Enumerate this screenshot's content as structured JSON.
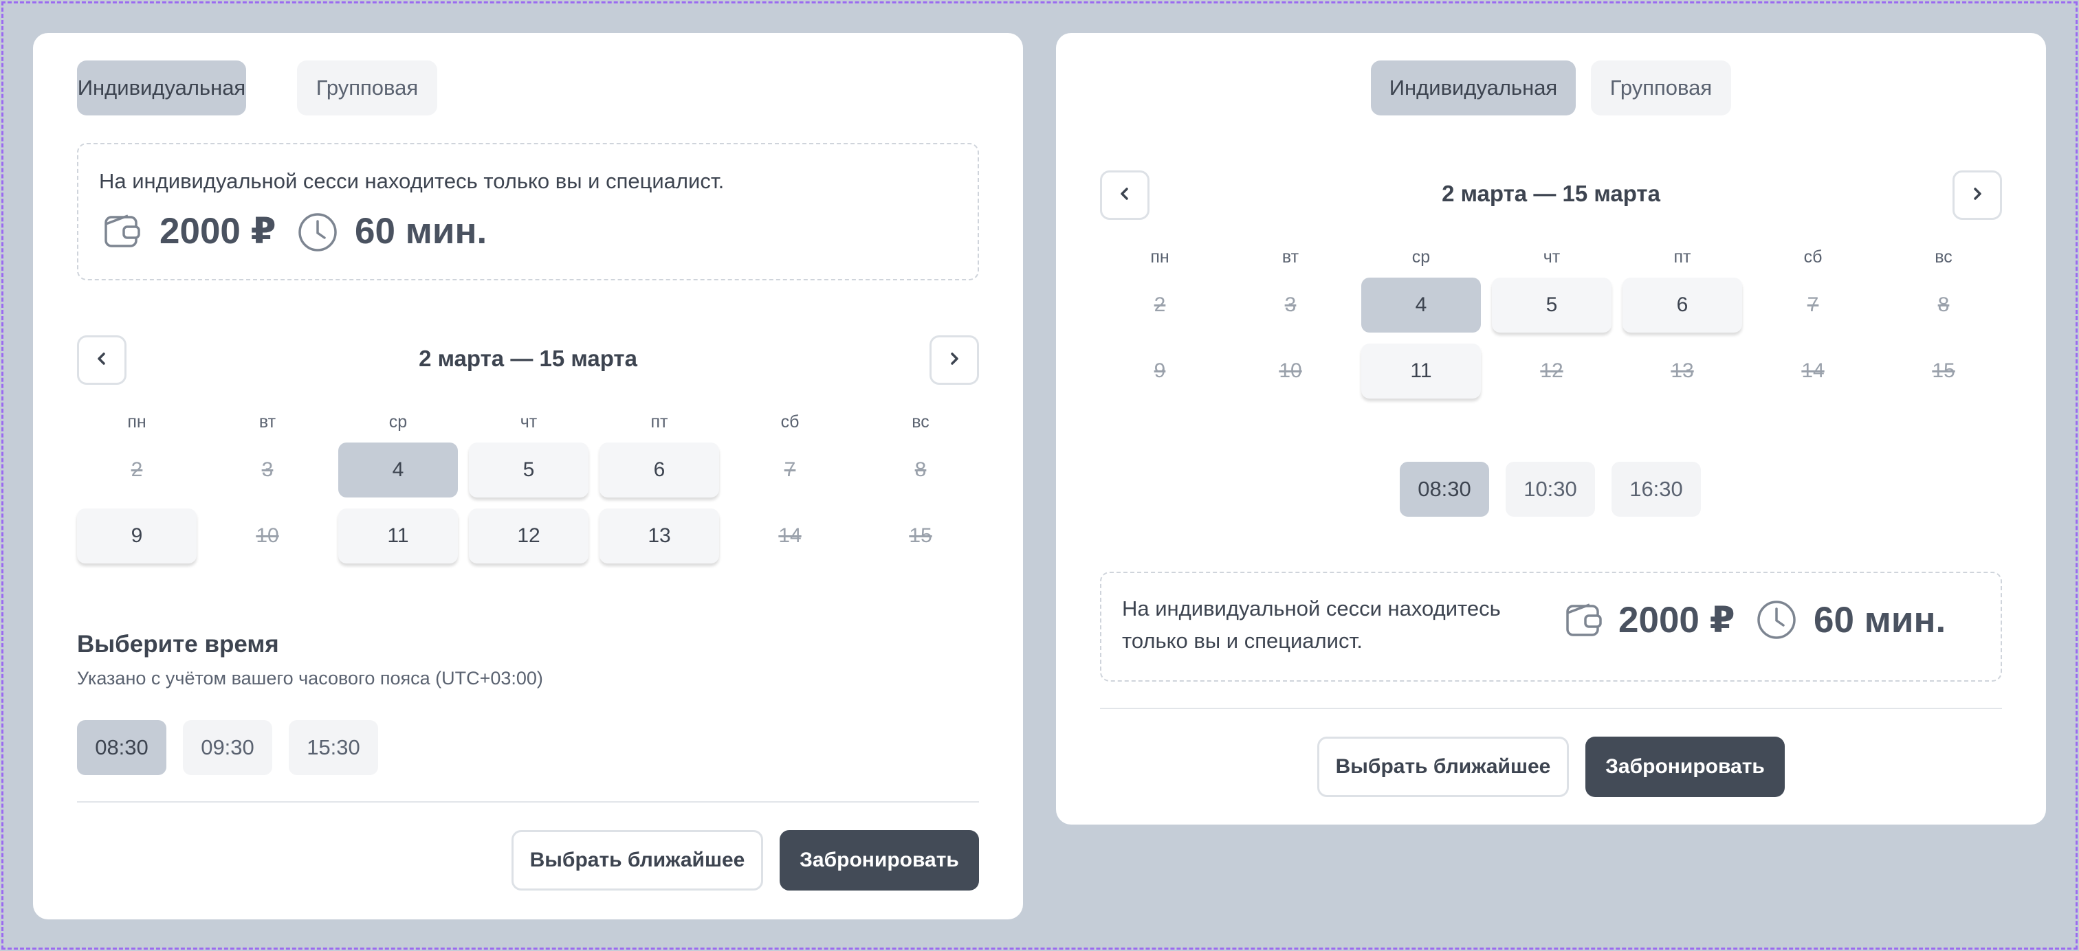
{
  "colors": {
    "page_bg": "#c5cdd7",
    "card_bg": "#ffffff",
    "selected_bg": "#c5ccd6",
    "available_bg": "#f5f6f8",
    "primary_button": "#434b57",
    "frame_dash": "#9b6bf0"
  },
  "icons": {
    "prev": "chevron-left-icon",
    "next": "chevron-right-icon",
    "price": "wallet-icon",
    "duration": "clock-icon"
  },
  "left": {
    "tabs": [
      {
        "label": "Индивидуальная",
        "active": true
      },
      {
        "label": "Групповая",
        "active": false
      }
    ],
    "info": {
      "text": "На индивидуальной сесси находитесь только вы и специалист.",
      "price": "2000 ₽",
      "duration": "60 мин."
    },
    "calendar": {
      "range": "2 марта — 15 марта",
      "weekdays": [
        "ПН",
        "ВТ",
        "СР",
        "ЧТ",
        "ПТ",
        "СБ",
        "ВС"
      ],
      "weeks": [
        [
          {
            "day": "2",
            "state": "disabled"
          },
          {
            "day": "3",
            "state": "disabled"
          },
          {
            "day": "4",
            "state": "selected"
          },
          {
            "day": "5",
            "state": "available"
          },
          {
            "day": "6",
            "state": "available"
          },
          {
            "day": "7",
            "state": "disabled"
          },
          {
            "day": "8",
            "state": "disabled"
          }
        ],
        [
          {
            "day": "9",
            "state": "available"
          },
          {
            "day": "10",
            "state": "disabled"
          },
          {
            "day": "11",
            "state": "available"
          },
          {
            "day": "12",
            "state": "available"
          },
          {
            "day": "13",
            "state": "available"
          },
          {
            "day": "14",
            "state": "disabled"
          },
          {
            "day": "15",
            "state": "disabled"
          }
        ]
      ]
    },
    "time": {
      "title": "Выберите время",
      "subtitle": "Указано с учётом вашего часового пояса (UTC+03:00)",
      "slots": [
        {
          "label": "08:30",
          "selected": true
        },
        {
          "label": "09:30",
          "selected": false
        },
        {
          "label": "15:30",
          "selected": false
        }
      ]
    },
    "actions": {
      "nearest": "Выбрать ближайшее",
      "book": "Забронировать"
    }
  },
  "right": {
    "tabs": [
      {
        "label": "Индивидуальная",
        "active": true
      },
      {
        "label": "Групповая",
        "active": false
      }
    ],
    "calendar": {
      "range": "2 марта — 15 марта",
      "weekdays": [
        "ПН",
        "ВТ",
        "СР",
        "ЧТ",
        "ПТ",
        "СБ",
        "ВС"
      ],
      "weeks": [
        [
          {
            "day": "2",
            "state": "disabled"
          },
          {
            "day": "3",
            "state": "disabled"
          },
          {
            "day": "4",
            "state": "selected"
          },
          {
            "day": "5",
            "state": "available"
          },
          {
            "day": "6",
            "state": "available"
          },
          {
            "day": "7",
            "state": "disabled"
          },
          {
            "day": "8",
            "state": "disabled"
          }
        ],
        [
          {
            "day": "9",
            "state": "disabled"
          },
          {
            "day": "10",
            "state": "disabled"
          },
          {
            "day": "11",
            "state": "available"
          },
          {
            "day": "12",
            "state": "disabled"
          },
          {
            "day": "13",
            "state": "disabled"
          },
          {
            "day": "14",
            "state": "disabled"
          },
          {
            "day": "15",
            "state": "disabled"
          }
        ]
      ]
    },
    "time": {
      "slots": [
        {
          "label": "08:30",
          "selected": true
        },
        {
          "label": "10:30",
          "selected": false
        },
        {
          "label": "16:30",
          "selected": false
        }
      ]
    },
    "info": {
      "text": "На индивидуальной сесси находитесь только вы и специалист.",
      "price": "2000 ₽",
      "duration": "60 мин."
    },
    "actions": {
      "nearest": "Выбрать ближайшее",
      "book": "Забронировать"
    }
  }
}
